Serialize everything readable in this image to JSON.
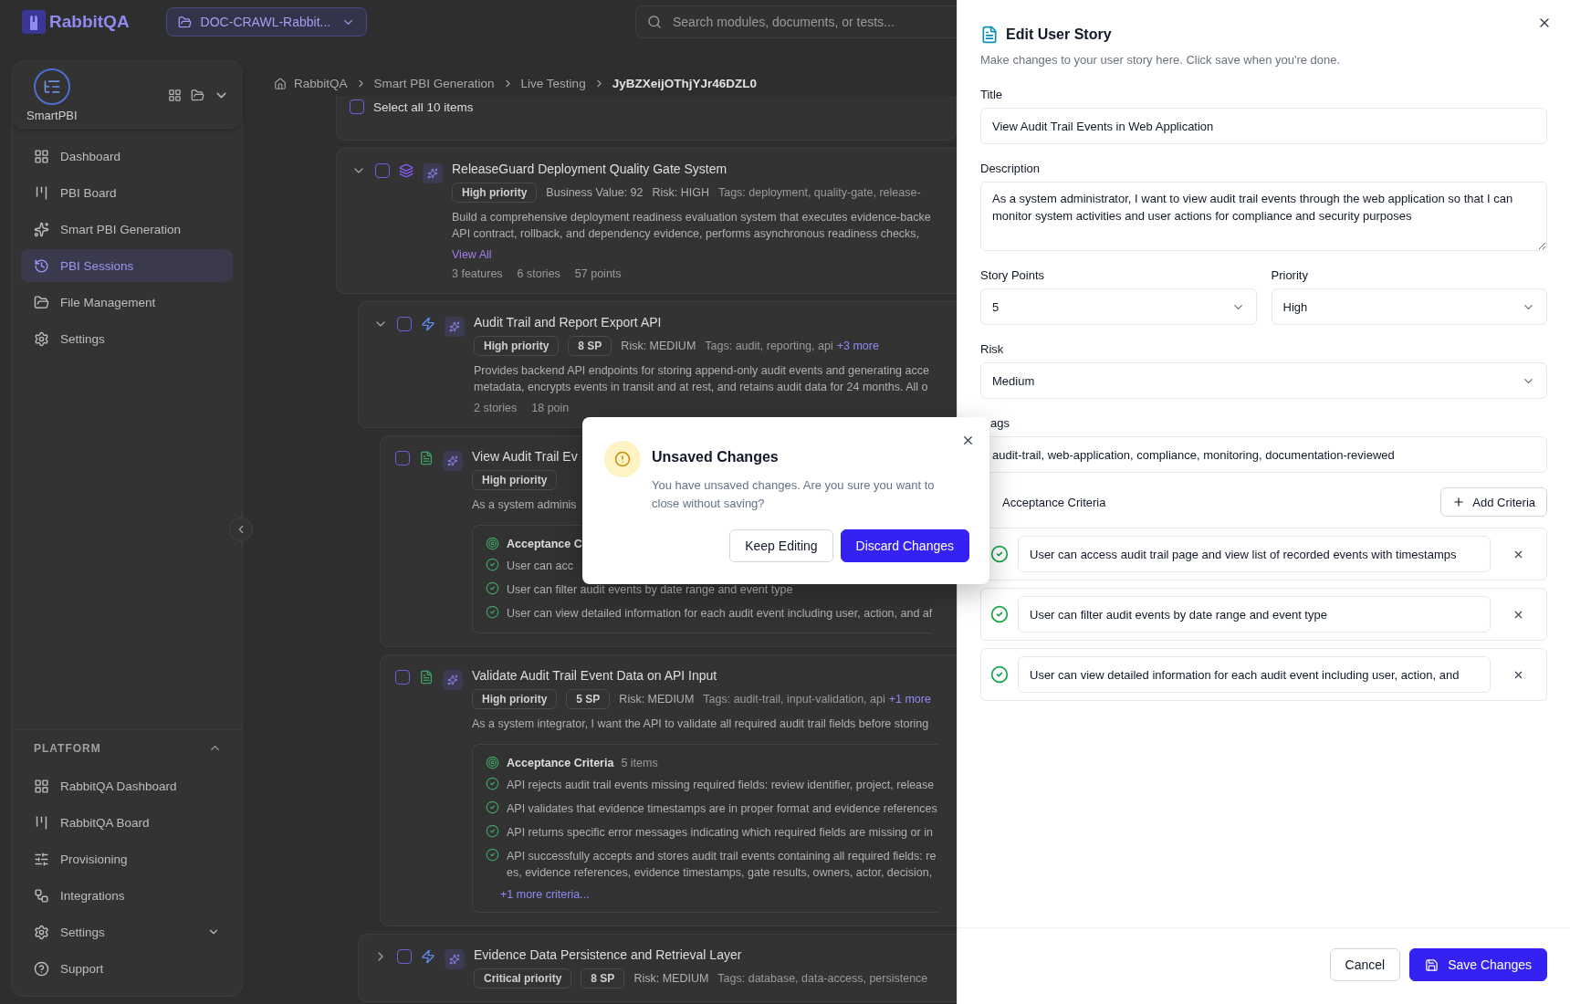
{
  "header": {
    "logo": "RabbitQA",
    "project": "DOC-CRAWL-Rabbit...",
    "search_placeholder": "Search modules, documents, or tests..."
  },
  "sidebar": {
    "app_name": "SmartPBI",
    "items": [
      {
        "label": "Dashboard",
        "selected": false
      },
      {
        "label": "PBI Board",
        "selected": false
      },
      {
        "label": "Smart PBI Generation",
        "selected": false
      },
      {
        "label": "PBI Sessions",
        "selected": true
      },
      {
        "label": "File Management",
        "selected": false
      },
      {
        "label": "Settings",
        "selected": false
      }
    ],
    "platform": {
      "title": "PLATFORM",
      "expanded": true,
      "items": [
        {
          "label": "RabbitQA Dashboard",
          "kind": "link"
        },
        {
          "label": "RabbitQA Board",
          "kind": "link"
        },
        {
          "label": "Provisioning",
          "kind": "link"
        },
        {
          "label": "Integrations",
          "kind": "link"
        },
        {
          "label": "Settings",
          "kind": "group"
        },
        {
          "label": "Support",
          "kind": "link"
        }
      ]
    }
  },
  "breadcrumb": [
    "RabbitQA",
    "Smart PBI Generation",
    "Live Testing",
    "JyBZXeijOThjYJr46DZL0"
  ],
  "select_all": {
    "label": "Select all 10 items",
    "checked": false
  },
  "items": [
    {
      "kind": "epic",
      "expanded": true,
      "checked": false,
      "title": "ReleaseGuard Deployment Quality Gate System",
      "meta": [
        {
          "kind": "badge",
          "text": "High priority"
        },
        {
          "kind": "info",
          "text": "Business Value: 92"
        },
        {
          "kind": "info",
          "text": "Risk: HIGH"
        },
        {
          "kind": "tags",
          "text": "Tags: deployment, quality-gate, release-"
        }
      ],
      "description": [
        "Build a comprehensive deployment readiness evaluation system that executes evidence-backe",
        "API contract, rollback, and dependency evidence, performs asynchronous readiness checks,"
      ],
      "link": "View All",
      "stats": [
        "3 features",
        "6 stories",
        "57 points"
      ],
      "children": [
        {
          "kind": "feature",
          "expanded": true,
          "checked": false,
          "title": "Audit Trail and Report Export API",
          "meta": [
            {
              "kind": "badge",
              "text": "High priority"
            },
            {
              "kind": "badge",
              "text": "8 SP"
            },
            {
              "kind": "info",
              "text": "Risk: MEDIUM"
            },
            {
              "kind": "tags",
              "text": "Tags: audit, reporting, api"
            },
            {
              "kind": "more",
              "text": "+3 more"
            }
          ],
          "description": [
            "Provides backend API endpoints for storing append-only audit events and generating acce",
            "metadata, encrypts events in transit and at rest, and retains audit data for 24 months. All o"
          ],
          "stats": [
            "2 stories",
            "18 poin"
          ],
          "children": [
            {
              "kind": "story",
              "checked": false,
              "title": "View Audit Trail Ev",
              "meta": [
                {
                  "kind": "badge",
                  "text": "High priority"
                }
              ],
              "description": [
                "As a system adminis"
              ],
              "criteria": {
                "title": "Acceptance C",
                "items": [
                  [
                    "User can acc"
                  ],
                  [
                    "User can filter audit events by date range and event type"
                  ],
                  [
                    "User can view detailed information for each audit event including user, action, and af"
                  ]
                ]
              }
            },
            {
              "kind": "story",
              "checked": false,
              "title": "Validate Audit Trail Event Data on API Input",
              "meta": [
                {
                  "kind": "badge",
                  "text": "High priority"
                },
                {
                  "kind": "badge",
                  "text": "5 SP"
                },
                {
                  "kind": "info",
                  "text": "Risk: MEDIUM"
                },
                {
                  "kind": "tags",
                  "text": "Tags: audit-trail, input-validation, api"
                },
                {
                  "kind": "more",
                  "text": "+1 more"
                }
              ],
              "description": [
                "As a system integrator, I want the API to validate all required audit trail fields before storing"
              ],
              "criteria": {
                "title": "Acceptance Criteria",
                "count": "5 items",
                "items": [
                  [
                    "API rejects audit trail events missing required fields: review identifier, project, release"
                  ],
                  [
                    "API validates that evidence timestamps are in proper format and evidence references"
                  ],
                  [
                    "API returns specific error messages indicating which required fields are missing or in"
                  ],
                  [
                    "API successfully accepts and stores audit trail events containing all required fields: re",
                    "es, evidence references, evidence timestamps, gate results, owners, actor, decision,"
                  ]
                ],
                "more": "+1 more criteria..."
              }
            }
          ]
        },
        {
          "kind": "feature",
          "expanded": false,
          "checked": false,
          "title": "Evidence Data Persistence and Retrieval Layer",
          "meta": [
            {
              "kind": "badge",
              "text": "Critical priority"
            },
            {
              "kind": "badge",
              "text": "8 SP"
            },
            {
              "kind": "info",
              "text": "Risk: MEDIUM"
            },
            {
              "kind": "tags",
              "text": "Tags: database, data-access, persistence"
            }
          ]
        }
      ]
    }
  ],
  "dialog": {
    "title": "Unsaved Changes",
    "message": "You have unsaved changes. Are you sure you want to close without saving?",
    "buttons": [
      {
        "label": "Keep Editing",
        "kind": "secondary"
      },
      {
        "label": "Discard Changes",
        "kind": "primary"
      }
    ]
  },
  "panel": {
    "title": "Edit User Story",
    "subtitle": "Make changes to your user story here. Click save when you're done.",
    "title_label": "Title",
    "title_value": "View Audit Trail Events in Web Application",
    "description_label": "Description",
    "description_value": "As a system administrator, I want to view audit trail events through the web application so that I can monitor system activities and user actions for compliance and security purposes",
    "story_points_label": "Story Points",
    "story_points_value": "5",
    "priority_label": "Priority",
    "priority_value": "High",
    "risk_label": "Risk",
    "risk_value": "Medium",
    "tags_label": "ags",
    "tags_value": "audit-trail, web-application, compliance, monitoring, documentation-reviewed",
    "criteria_label": "Acceptance Criteria",
    "add_button": "Add Criteria",
    "criteria": [
      "User can access audit trail page and view list of recorded events with timestamps",
      "User can filter audit events by date range and event type",
      "User can view detailed information for each audit event including user, action, and"
    ],
    "buttons": [
      {
        "label": "Cancel",
        "kind": "secondary"
      },
      {
        "label": "Save Changes",
        "kind": "primary"
      }
    ]
  }
}
